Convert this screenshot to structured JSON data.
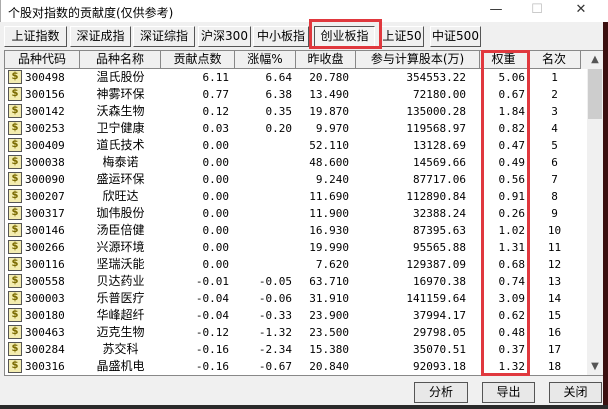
{
  "window": {
    "title": "个股对指数的贡献度(仅供参考)",
    "minimize": "—",
    "maximize": "☐",
    "close": "✕"
  },
  "tabs": [
    "上证指数",
    "深证成指",
    "深证综指",
    "沪深300",
    "中小板指",
    "创业板指",
    "上证50",
    "中证500"
  ],
  "active_tab": "创业板指",
  "columns": [
    "品种代码",
    "品种名称",
    "贡献点数",
    "涨幅%",
    "昨收盘",
    "参与计算股本(万)",
    "权重",
    "名次"
  ],
  "rows": [
    [
      "300498",
      "温氏股份",
      "6.11",
      "6.64",
      "20.780",
      "354553.22",
      "5.06",
      "1"
    ],
    [
      "300156",
      "神雾环保",
      "0.77",
      "6.38",
      "13.490",
      "72180.00",
      "0.67",
      "2"
    ],
    [
      "300142",
      "沃森生物",
      "0.12",
      "0.35",
      "19.870",
      "135000.28",
      "1.84",
      "3"
    ],
    [
      "300253",
      "卫宁健康",
      "0.03",
      "0.20",
      "9.970",
      "119568.97",
      "0.82",
      "4"
    ],
    [
      "300409",
      "道氏技术",
      "0.00",
      "",
      "52.110",
      "13128.69",
      "0.47",
      "5"
    ],
    [
      "300038",
      "梅泰诺",
      "0.00",
      "",
      "48.600",
      "14569.66",
      "0.49",
      "6"
    ],
    [
      "300090",
      "盛运环保",
      "0.00",
      "",
      "9.240",
      "87717.06",
      "0.56",
      "7"
    ],
    [
      "300207",
      "欣旺达",
      "0.00",
      "",
      "11.690",
      "112890.84",
      "0.91",
      "8"
    ],
    [
      "300317",
      "珈伟股份",
      "0.00",
      "",
      "11.900",
      "32388.24",
      "0.26",
      "9"
    ],
    [
      "300146",
      "汤臣倍健",
      "0.00",
      "",
      "16.930",
      "87395.63",
      "1.02",
      "10"
    ],
    [
      "300266",
      "兴源环境",
      "0.00",
      "",
      "19.990",
      "95565.88",
      "1.31",
      "11"
    ],
    [
      "300116",
      "坚瑞沃能",
      "0.00",
      "",
      "7.620",
      "129387.09",
      "0.68",
      "12"
    ],
    [
      "300558",
      "贝达药业",
      "-0.01",
      "-0.05",
      "63.710",
      "16970.38",
      "0.74",
      "13"
    ],
    [
      "300003",
      "乐普医疗",
      "-0.04",
      "-0.06",
      "31.910",
      "141159.64",
      "3.09",
      "14"
    ],
    [
      "300180",
      "华峰超纤",
      "-0.04",
      "-0.33",
      "23.900",
      "37994.17",
      "0.62",
      "15"
    ],
    [
      "300463",
      "迈克生物",
      "-0.12",
      "-1.32",
      "23.500",
      "29798.05",
      "0.48",
      "16"
    ],
    [
      "300284",
      "苏交科",
      "-0.16",
      "-2.34",
      "15.380",
      "35070.51",
      "0.37",
      "17"
    ],
    [
      "300316",
      "晶盛机电",
      "-0.16",
      "-0.67",
      "20.840",
      "92093.18",
      "1.32",
      "18"
    ]
  ],
  "row_icon": "$",
  "buttons": {
    "analyze": "分析",
    "export": "导出",
    "close": "关闭"
  },
  "colors": {
    "highlight": "#e0383e"
  }
}
